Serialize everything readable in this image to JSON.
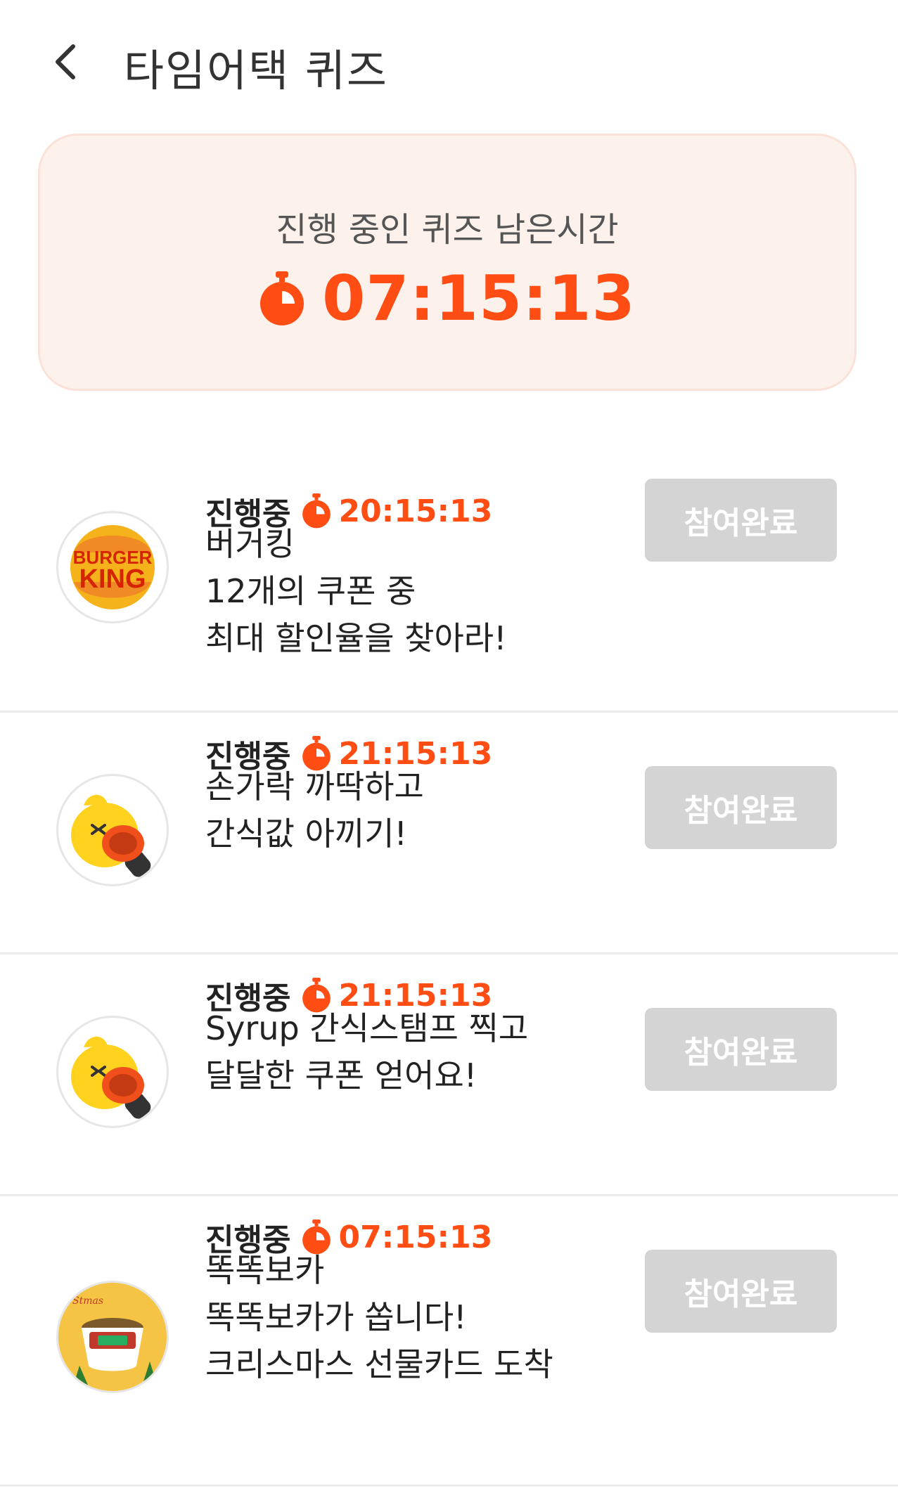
{
  "header": {
    "title": "타임어택 퀴즈"
  },
  "timer_card": {
    "label": "진행 중인 퀴즈 남은시간",
    "remaining": "07:15:13"
  },
  "brand_logo": {
    "line1": "BURGER",
    "line2": "KING"
  },
  "noodle_logo": {
    "text": "Stmas"
  },
  "colors": {
    "accent": "#ff4d14",
    "card_bg": "#fdf1ec",
    "button_disabled": "#d4d4d4"
  },
  "quizzes": [
    {
      "status": "진행중",
      "timer": "20:15:13",
      "lines": [
        "버거킹",
        "12개의 쿠폰 중",
        "최대 할인율을 찾아라!"
      ],
      "button": "참여완료",
      "icon": "burger-king-logo"
    },
    {
      "status": "진행중",
      "timer": "21:15:13",
      "lines": [
        "손가락 까딱하고",
        "간식값 아끼기!"
      ],
      "button": "참여완료",
      "icon": "apeach-stamp-character"
    },
    {
      "status": "진행중",
      "timer": "21:15:13",
      "lines": [
        "Syrup 간식스탬프 찍고",
        "달달한 쿠폰 얻어요!"
      ],
      "button": "참여완료",
      "icon": "apeach-stamp-character"
    },
    {
      "status": "진행중",
      "timer": "07:15:13",
      "lines": [
        "똑똑보카",
        "똑똑보카가 쏩니다!",
        "크리스마스 선물카드 도착"
      ],
      "button": "참여완료",
      "icon": "instant-noodle-cup"
    }
  ]
}
